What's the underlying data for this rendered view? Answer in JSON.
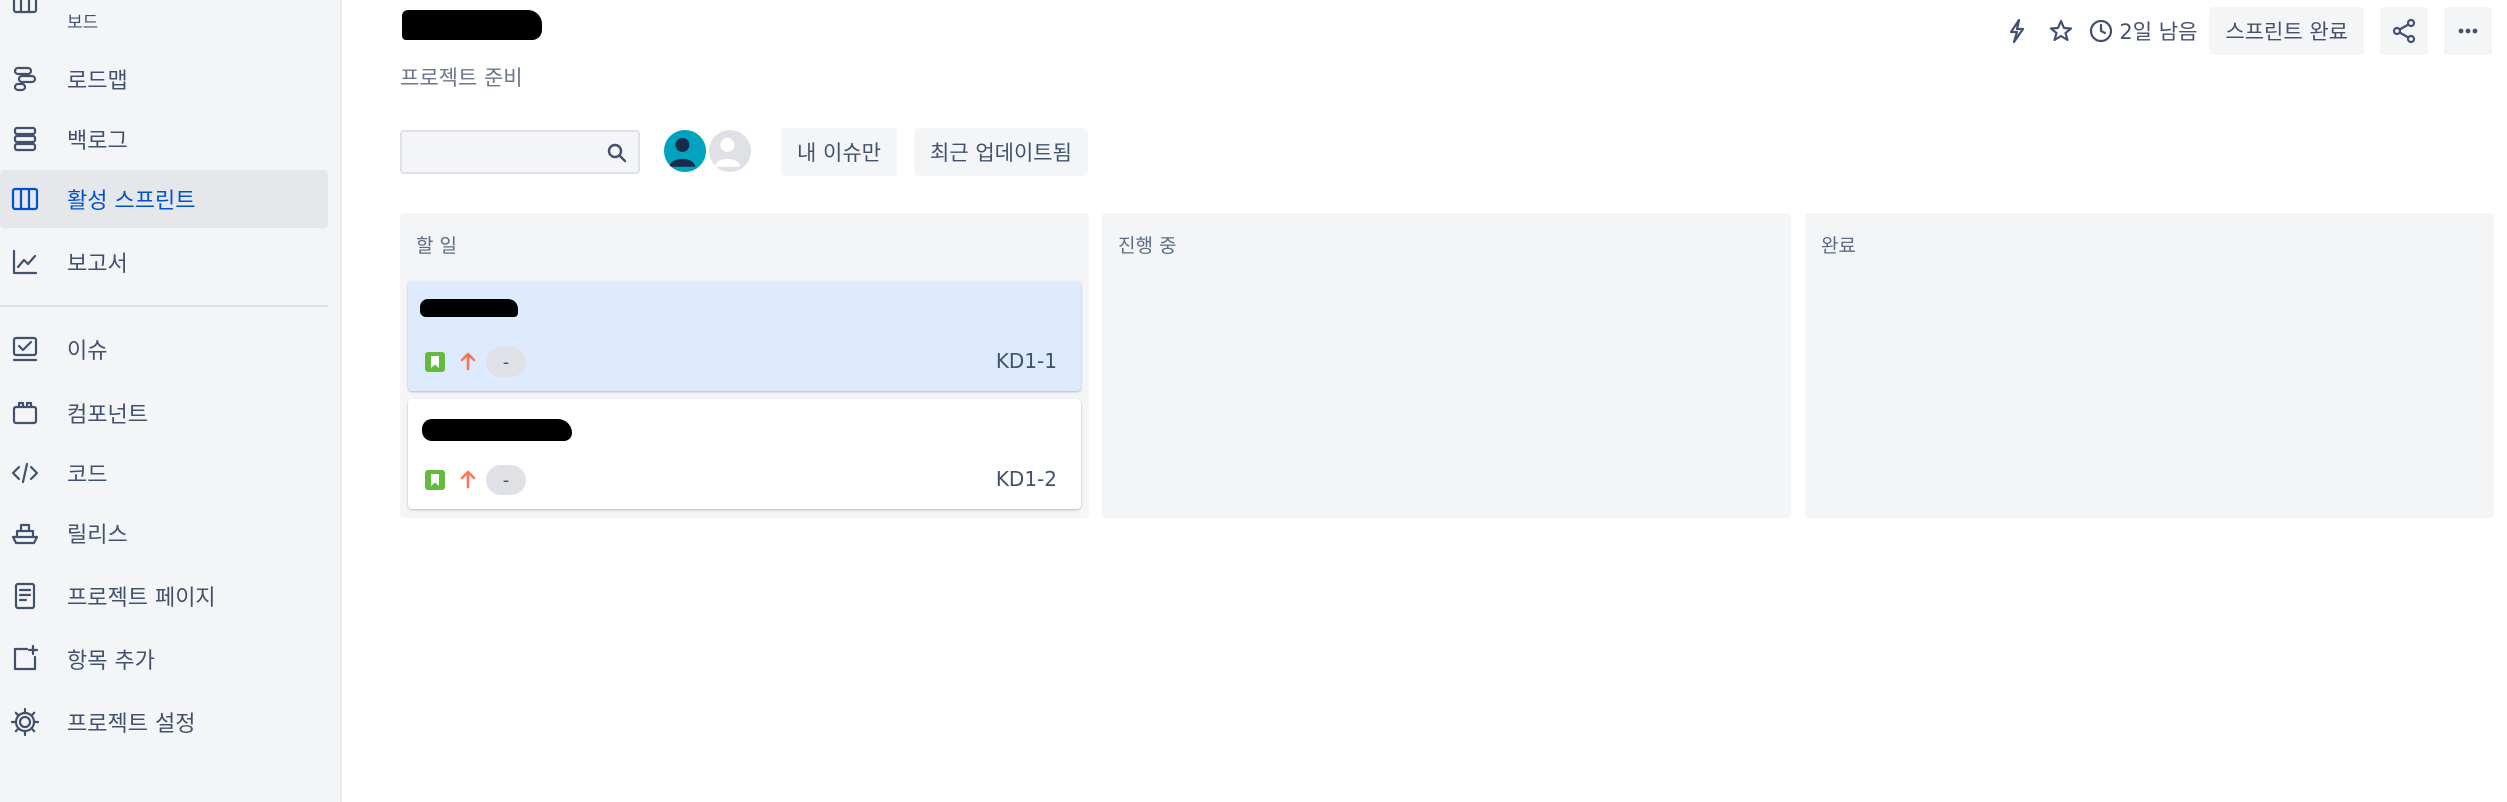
{
  "sidebar": {
    "top_label": "보드",
    "items": [
      {
        "label": "로드맵",
        "icon": "roadmap-icon",
        "active": false
      },
      {
        "label": "백로그",
        "icon": "backlog-icon",
        "active": false
      },
      {
        "label": "활성 스프린트",
        "icon": "board-columns-icon",
        "active": true
      },
      {
        "label": "보고서",
        "icon": "chart-line-icon",
        "active": false
      },
      {
        "label": "이슈",
        "icon": "issues-icon",
        "active": false
      },
      {
        "label": "컴포넌트",
        "icon": "component-icon",
        "active": false
      },
      {
        "label": "코드",
        "icon": "code-icon",
        "active": false
      },
      {
        "label": "릴리스",
        "icon": "ship-icon",
        "active": false
      },
      {
        "label": "프로젝트 페이지",
        "icon": "page-icon",
        "active": false
      },
      {
        "label": "항목 추가",
        "icon": "add-item-icon",
        "active": false
      },
      {
        "label": "프로젝트 설정",
        "icon": "gear-icon",
        "active": false
      }
    ]
  },
  "header": {
    "subtitle": "프로젝트 준비",
    "time_remaining": "2일 남음",
    "complete_sprint_label": "스프린트 완료"
  },
  "filters": {
    "search_value": "",
    "my_issues_label": "내 이슈만",
    "recently_updated_label": "최근 업데이트됨"
  },
  "board": {
    "columns": [
      {
        "title": "할 일",
        "cards": [
          {
            "key": "KD1-1",
            "estimate": "-",
            "selected": true
          },
          {
            "key": "KD1-2",
            "estimate": "-",
            "selected": false
          }
        ]
      },
      {
        "title": "진행 중",
        "cards": []
      },
      {
        "title": "완료",
        "cards": []
      }
    ]
  },
  "colors": {
    "accent": "#0052cc",
    "story_green": "#63ba3c",
    "priority_orange": "#ff7452",
    "selected_card": "#deebff",
    "avatar_teal": "#00a3bf"
  }
}
